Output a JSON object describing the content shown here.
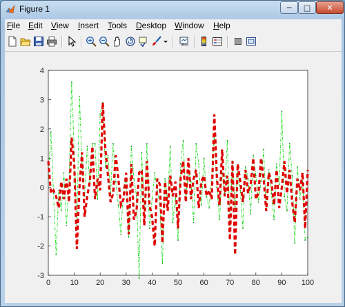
{
  "window": {
    "title": "Figure 1",
    "minimize_glyph": "─",
    "maximize_glyph": "□",
    "close_glyph": "✕"
  },
  "menu": [
    {
      "label": "File",
      "mnemonic": "F"
    },
    {
      "label": "Edit",
      "mnemonic": "E"
    },
    {
      "label": "View",
      "mnemonic": "V"
    },
    {
      "label": "Insert",
      "mnemonic": "I"
    },
    {
      "label": "Tools",
      "mnemonic": "T"
    },
    {
      "label": "Desktop",
      "mnemonic": "D"
    },
    {
      "label": "Window",
      "mnemonic": "W"
    },
    {
      "label": "Help",
      "mnemonic": "H"
    }
  ],
  "toolbar": [
    "new-figure-icon",
    "open-file-icon",
    "save-icon",
    "print-icon",
    "pointer-icon",
    "zoom-in-icon",
    "zoom-out-icon",
    "pan-icon",
    "rotate-3d-icon",
    "data-cursor-icon",
    "brush-icon",
    "dropdown-arrow-icon",
    "link-plot-icon",
    "colorbar-icon",
    "legend-icon",
    "hide-plot-tools-icon",
    "show-plot-tools-icon"
  ],
  "colors": {
    "series1": "#22dd22",
    "series2": "#e00000"
  },
  "chart_data": {
    "type": "line",
    "xlim": [
      0,
      100
    ],
    "ylim": [
      -3,
      4
    ],
    "xticks": [
      "0",
      "10",
      "20",
      "30",
      "40",
      "50",
      "60",
      "70",
      "80",
      "90",
      "100"
    ],
    "yticks": [
      "-3",
      "-2",
      "-1",
      "0",
      "1",
      "2",
      "3",
      "4"
    ],
    "grid": false,
    "series": [
      {
        "style": "dash-dot with point markers",
        "color": "#22dd22",
        "values": [
          0.3,
          1.9,
          -0.2,
          -2.3,
          -0.1,
          -0.8,
          0.5,
          -1.3,
          0.2,
          3.6,
          1.2,
          -1.3,
          3.1,
          0.8,
          -0.3,
          1.4,
          0.1,
          1.5,
          1.5,
          -0.4,
          2.5,
          2.9,
          0.7,
          1.1,
          -0.2,
          1.5,
          0.2,
          -0.6,
          -1.6,
          0.0,
          0.3,
          -1.7,
          1.4,
          0.3,
          -0.3,
          -3.1,
          1.2,
          -0.9,
          1.5,
          -1.4,
          -0.4,
          0.5,
          -0.1,
          -0.6,
          -2.6,
          0.3,
          -0.5,
          1.4,
          -1.2,
          -0.3,
          -1.8,
          0.8,
          1.6,
          -0.4,
          0.6,
          0.2,
          -1.2,
          1.5,
          0.8,
          -0.6,
          1.0,
          -0.3,
          -0.7,
          0.4,
          1.8,
          0.0,
          -1.1,
          0.5,
          -0.2,
          1.6,
          -1.3,
          0.9,
          -0.7,
          0.6,
          -0.1,
          -1.4,
          0.7,
          0.3,
          -0.9,
          1.1,
          0.4,
          -0.5,
          0.2,
          1.3,
          -0.8,
          0.6,
          -0.2,
          -1.1,
          0.8,
          0.1,
          2.6,
          -0.3,
          -0.8,
          1.5,
          0.4,
          -1.9,
          0.7,
          -0.4,
          0.3,
          -1.8,
          -1.7
        ]
      },
      {
        "style": "thick dashed",
        "color": "#e00000",
        "values": [
          0.9,
          -0.2,
          -0.1,
          -0.3,
          -0.7,
          0.2,
          -0.4,
          0.3,
          -0.5,
          1.7,
          0.8,
          -2.1,
          0.0,
          1.2,
          -1.0,
          -0.3,
          0.2,
          1.4,
          -0.4,
          0.3,
          -0.1,
          2.9,
          1.3,
          0.4,
          -0.5,
          -0.2,
          1.1,
          0.3,
          -0.6,
          -0.4,
          0.5,
          -1.6,
          0.8,
          -1.1,
          -0.8,
          0.5,
          0.6,
          -1.3,
          0.9,
          -0.6,
          -1.0,
          -2.0,
          0.3,
          0.1,
          -1.9,
          0.2,
          -0.8,
          0.4,
          -0.3,
          0.2,
          -1.4,
          0.3,
          0.9,
          -0.5,
          1.0,
          -0.4,
          0.3,
          0.6,
          -0.7,
          0.2,
          0.4,
          -0.3,
          -0.1,
          -0.4,
          2.5,
          0.3,
          -0.6,
          1.3,
          -0.3,
          0.4,
          -1.8,
          0.9,
          -2.3,
          0.8,
          0.2,
          -0.5,
          0.6,
          -0.2,
          0.1,
          1.0,
          -0.4,
          -0.2,
          1.0,
          0.3,
          -0.8,
          0.5,
          0.2,
          -0.6,
          0.6,
          -0.7,
          0.0,
          0.9,
          -0.2,
          0.6,
          -0.5,
          -1.2,
          0.3,
          -0.1,
          0.5,
          -1.4,
          0.6
        ]
      }
    ]
  }
}
